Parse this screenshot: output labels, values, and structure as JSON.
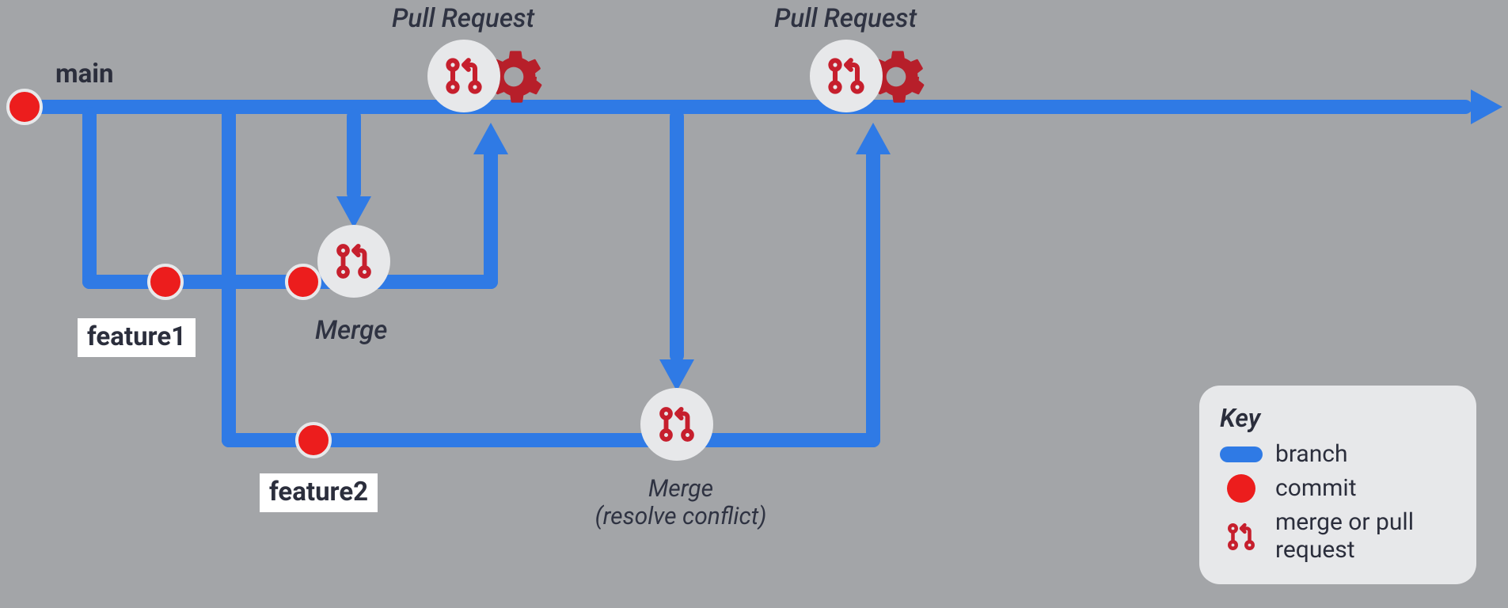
{
  "labels": {
    "main": "main",
    "feature1": "feature1",
    "feature2": "feature2",
    "pull_request_1": "Pull Request",
    "pull_request_2": "Pull Request",
    "merge_1": "Merge",
    "merge_2_line1": "Merge",
    "merge_2_line2": "(resolve conflict)"
  },
  "key": {
    "title": "Key",
    "branch": "branch",
    "commit": "commit",
    "merge_or_pr": "merge or pull request"
  },
  "colors": {
    "branch": "#2f7ae5",
    "commit": "#ec1d1d",
    "accent_red": "#c61f2d",
    "circle_bg": "#e7e8ea"
  }
}
